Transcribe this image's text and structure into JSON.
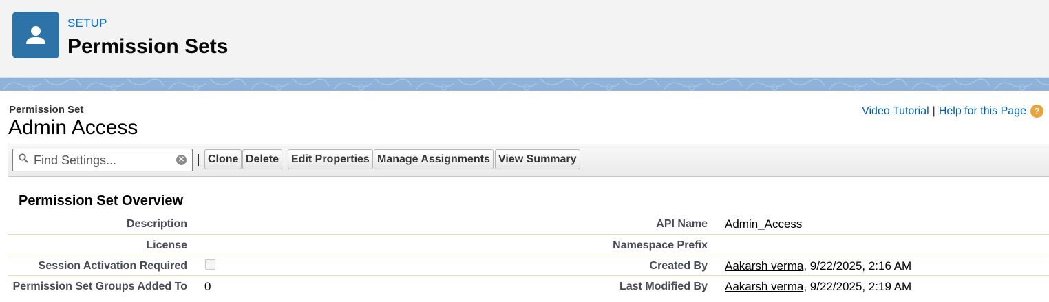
{
  "header": {
    "breadcrumb": "SETUP",
    "title": "Permission Sets",
    "icon": "user-icon"
  },
  "record": {
    "type_label": "Permission Set",
    "name": "Admin Access"
  },
  "help": {
    "video_tutorial": "Video Tutorial",
    "separator": "|",
    "help_page": "Help for this Page",
    "help_icon_glyph": "?"
  },
  "toolbar": {
    "search_placeholder": "Find Settings...",
    "clear_glyph": "✕",
    "buttons": [
      "Clone",
      "Delete",
      "Edit Properties",
      "Manage Assignments",
      "View Summary"
    ]
  },
  "overview": {
    "title": "Permission Set Overview",
    "rows": [
      {
        "left_label": "Description",
        "left_value": "",
        "right_label": "API Name",
        "right_value": "Admin_Access"
      },
      {
        "left_label": "License",
        "left_value": "",
        "right_label": "Namespace Prefix",
        "right_value": ""
      },
      {
        "left_label": "Session Activation Required",
        "left_value": "unchecked",
        "right_label": "Created By",
        "right_link": "Aakarsh verma",
        "right_suffix": ", 9/22/2025, 2:16 AM"
      },
      {
        "left_label": "Permission Set Groups Added To",
        "left_value": "0",
        "right_label": "Last Modified By",
        "right_link": "Aakarsh verma",
        "right_suffix": ", 9/22/2025, 2:19 AM"
      }
    ]
  },
  "colors": {
    "header_bg": "#f3f3f3",
    "icon_bg": "#2e73a8",
    "banner": "#8fb2d9",
    "link": "#015ba7"
  }
}
